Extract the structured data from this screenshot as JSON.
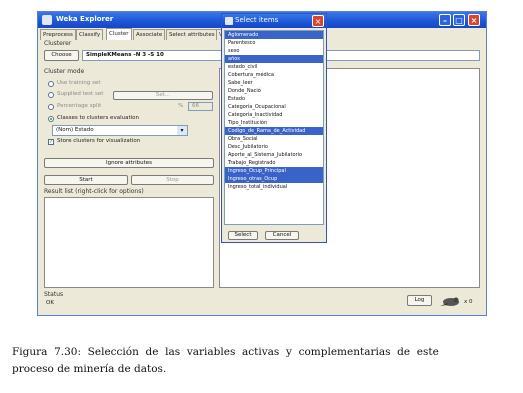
{
  "window": {
    "title": "Weka Explorer",
    "controls": {
      "minimize": "–",
      "maximize": "□",
      "close": "×"
    }
  },
  "tabs": [
    "Preprocess",
    "Classify",
    "Cluster",
    "Associate",
    "Select attributes",
    "V"
  ],
  "active_tab": 2,
  "clusterer": {
    "section_label": "Clusterer",
    "choose_label": "Choose",
    "config": "SimpleKMeans -N 3 -S 10"
  },
  "cluster_mode": {
    "section_label": "Cluster mode",
    "options": [
      {
        "label": "Use training set",
        "selected": false,
        "enabled": false
      },
      {
        "label": "Supplied test set",
        "selected": false,
        "enabled": false
      },
      {
        "label": "Percentage split",
        "selected": false,
        "enabled": false
      },
      {
        "label": "Classes to clusters evaluation",
        "selected": true,
        "enabled": true
      }
    ],
    "set_label": "Set...",
    "percent_symbol": "%",
    "percent_value": "66",
    "class_select_value": "(Nom) Estado",
    "store_clusters_label": "Store clusters for visualization",
    "store_clusters_checked": true
  },
  "ignore_attributes_label": "Ignore attributes",
  "start_label": "Start",
  "stop_label": "Stop",
  "result_list_label": "Result list (right-click for options)",
  "status": {
    "section_label": "Status",
    "text": "OK",
    "log_label": "Log",
    "count": "x 0"
  },
  "dialog": {
    "title": "Select items",
    "close": "×",
    "items": [
      {
        "label": "Aglomerado",
        "selected": true
      },
      {
        "label": "Parentesco",
        "selected": false
      },
      {
        "label": "sexo",
        "selected": false
      },
      {
        "label": "años",
        "selected": true
      },
      {
        "label": "estado_civil",
        "selected": false
      },
      {
        "label": "Cobertura_médica",
        "selected": false
      },
      {
        "label": "Sabe_leer",
        "selected": false
      },
      {
        "label": "Donde_Nació",
        "selected": false
      },
      {
        "label": "Estado",
        "selected": false
      },
      {
        "label": "Categoría_Ocupacional",
        "selected": false
      },
      {
        "label": "Categoría_Inactividad",
        "selected": false
      },
      {
        "label": "Tipo_Institución",
        "selected": false
      },
      {
        "label": "Codigo_de_Rama_de_Actividad",
        "selected": true
      },
      {
        "label": "Obra_Social",
        "selected": false
      },
      {
        "label": "Desc_Jubilatorio",
        "selected": false
      },
      {
        "label": "Aporte_al_Sistema_Jubilatorio",
        "selected": false
      },
      {
        "label": "Trabajo_Registrado",
        "selected": false
      },
      {
        "label": "Ingreso_Ocup_Principal",
        "selected": true
      },
      {
        "label": "Ingreso_otras_Ocup",
        "selected": true
      },
      {
        "label": "Ingreso_total_individual",
        "selected": false
      }
    ],
    "select_label": "Select",
    "cancel_label": "Cancel"
  },
  "caption": {
    "line1": "Figura  7.30:  Selección  de  las  variables  activas  y  complementarias  de  este",
    "line2": "proceso de minería de datos."
  }
}
